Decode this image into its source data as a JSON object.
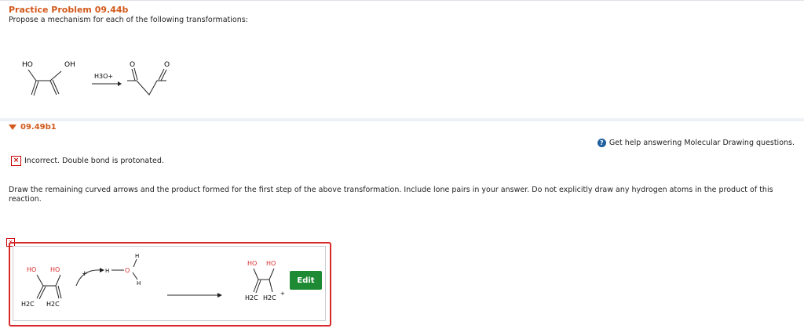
{
  "problem": {
    "title": "Practice Problem 09.44b",
    "prompt": "Propose a mechanism for each of the following transformations:",
    "reagent": "H3O+",
    "reactant_labels": [
      "HO",
      "OH"
    ],
    "product_labels": [
      "O",
      "O"
    ]
  },
  "part": {
    "label": "09.49b1",
    "help_text": "Get help answering Molecular Drawing questions.",
    "feedback": "Incorrect. Double bond is protonated.",
    "instructions": "Draw the remaining curved arrows and the product formed for the first step of the above transformation. Include lone pairs in your answer. Do not explicitly draw any hydrogen atoms in the product of this reaction."
  },
  "answer": {
    "left_labels": [
      "HO",
      "HO",
      "H2C",
      "H2C",
      "H",
      "O",
      "H",
      "H",
      "+"
    ],
    "right_labels": [
      "HO",
      "HO",
      "H2C",
      "H2C",
      "+"
    ],
    "edit_label": "Edit"
  },
  "colors": {
    "title_orange": "#d2591b",
    "error_red": "#d62a2a",
    "edit_green": "#1f8a34",
    "help_blue": "#1f5f9e"
  }
}
